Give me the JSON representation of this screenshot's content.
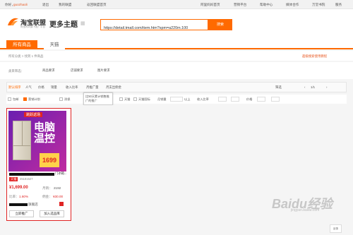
{
  "topnav": {
    "greeting": "你好，",
    "username": "guozhaoli",
    "logout": "退出",
    "my_alliance": "我的联盟",
    "back_home": "返回联盟首页",
    "links": [
      "阿里妈妈首页",
      "营销平台",
      "帮助中心",
      "媒体合作",
      "万堂书院",
      "服务"
    ]
  },
  "header": {
    "logo_text": "淘宝联盟",
    "logo_sub": "阿里妈妈旗下推广平台",
    "title": "更多主题",
    "search_value": "https://detail.tmall.com/item.htm?spm=a220m.100",
    "search_button": "搜索"
  },
  "tabs": [
    {
      "label": "所有商品",
      "active": true
    },
    {
      "label": "天猫",
      "active": false
    }
  ],
  "breadcrumb": {
    "path": "所有分类 > 找到 1 件商品",
    "right_link": "超级搜索使用教程"
  },
  "filters": {
    "category_label": "类目筛选：",
    "dropdowns": [
      "商品要求",
      "店铺要求",
      "图片要求"
    ]
  },
  "sortbar": {
    "items": [
      "默认排序",
      "人气",
      "价格",
      "销量",
      "收入比率",
      "月推广量",
      "月支出佣金"
    ],
    "right_link": "筛选",
    "page": "1/1"
  },
  "checks": {
    "items": [
      "包邮",
      "营销计划",
      "消保",
      "店铺优惠",
      "天猫",
      "天猫国际",
      "淘宝",
      "优惠券",
      "阿里健康",
      "月销量",
      "收入比率"
    ],
    "range_sep": "以上",
    "price_label": "价格"
  },
  "tooltip": "比50天累计销售推广的推广",
  "product": {
    "badge": "跳跃返场",
    "promo_title": "电脑温控",
    "promo_price": "1699",
    "name_tail": "门冰箱...",
    "shop_tag": "天猫",
    "shop_id": "45181527",
    "price": "¥1,699.00",
    "monthly_sales_label": "月销：",
    "monthly_sales": "2192",
    "commission_rate_label": "比率：",
    "commission_rate": "1.60%",
    "commission_label": "佣金：",
    "commission": "¥30.00",
    "seller_name": "旗舰店",
    "promote_button": "立即推广",
    "favorite_button": "加入选品库"
  },
  "watermark": "Baidu经验",
  "watermark_sub": "jingyan.baidu.com",
  "corner_button": "反馈",
  "colors": {
    "accent": "#ff6a00",
    "highlight": "#e02424"
  }
}
